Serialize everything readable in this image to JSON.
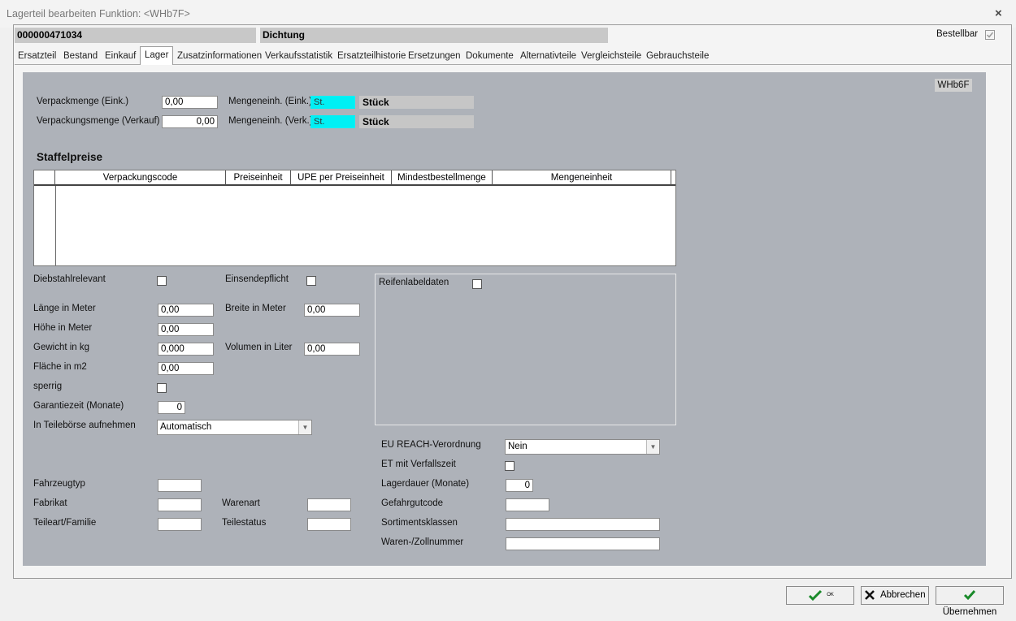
{
  "window": {
    "title": "Lagerteil bearbeiten   Funktion: <WHb7F>",
    "close_glyph": "×"
  },
  "header": {
    "part_number": "000000471034",
    "description": "Dichtung",
    "orderable_label": "Bestellbar"
  },
  "tabs": [
    "Ersatzteil",
    "Bestand",
    "Einkauf",
    "Lager",
    "Zusatzinformationen",
    "Verkaufsstatistik",
    "Ersatzteilhistorie",
    "Ersetzungen",
    "Dokumente",
    "Alternativteile",
    "Vergleichsteile",
    "Gebrauchsteile"
  ],
  "active_tab": "Lager",
  "panel": {
    "code_tag": "WHb6F",
    "pack_purchase": {
      "label": "Verpackmenge (Eink.)",
      "value": "0,00",
      "unit_label": "Mengeneinh. (Eink.)",
      "unit_code": "St.",
      "unit_name": "Stück"
    },
    "pack_sale": {
      "label": "Verpackungsmenge (Verkauf)",
      "value": "0,00",
      "unit_label": "Mengeneinh. (Verk.)",
      "unit_code": "St.",
      "unit_name": "Stück"
    },
    "staffel": {
      "title": "Staffelpreise",
      "columns": [
        "Verpackungscode",
        "Preiseinheit",
        "UPE per Preiseinheit",
        "Mindestbestellmenge",
        "Mengeneinheit"
      ]
    },
    "fields": {
      "diebstahl": "Diebstahlrelevant",
      "einsende": "Einsendepflicht",
      "reifen": "Reifenlabeldaten",
      "laenge": {
        "label": "Länge in Meter",
        "value": "0,00"
      },
      "breite": {
        "label": "Breite in Meter",
        "value": "0,00"
      },
      "hoehe": {
        "label": "Höhe in Meter",
        "value": "0,00"
      },
      "gewicht": {
        "label": "Gewicht in kg",
        "value": "0,000"
      },
      "volumen": {
        "label": "Volumen in Liter",
        "value": "0,00"
      },
      "flaeche": {
        "label": "Fläche in m2",
        "value": "0,00"
      },
      "sperrig": "sperrig",
      "garantie": {
        "label": "Garantiezeit (Monate)",
        "value": "0"
      },
      "teileboerse": {
        "label": "In Teilebörse aufnehmen",
        "value": "Automatisch"
      },
      "reach": {
        "label": "EU REACH-Verordnung",
        "value": "Nein"
      },
      "verfall": "ET mit Verfallszeit",
      "lagerdauer": {
        "label": "Lagerdauer (Monate)",
        "value": "0"
      },
      "gefahrgut": "Gefahrgutcode",
      "sortiment": "Sortimentsklassen",
      "zoll": "Waren-/Zollnummer",
      "fahrzeugtyp": "Fahrzeugtyp",
      "fabrikat": "Fabrikat",
      "warenart": "Warenart",
      "teileart": "Teileart/Familie",
      "teilestatus": "Teilestatus"
    }
  },
  "buttons": {
    "ok": "OK",
    "cancel": "Abbrechen",
    "apply": "Übernehmen"
  },
  "colors": {
    "panel": "#aeb2b9",
    "unit_highlight": "#00f0f4"
  }
}
